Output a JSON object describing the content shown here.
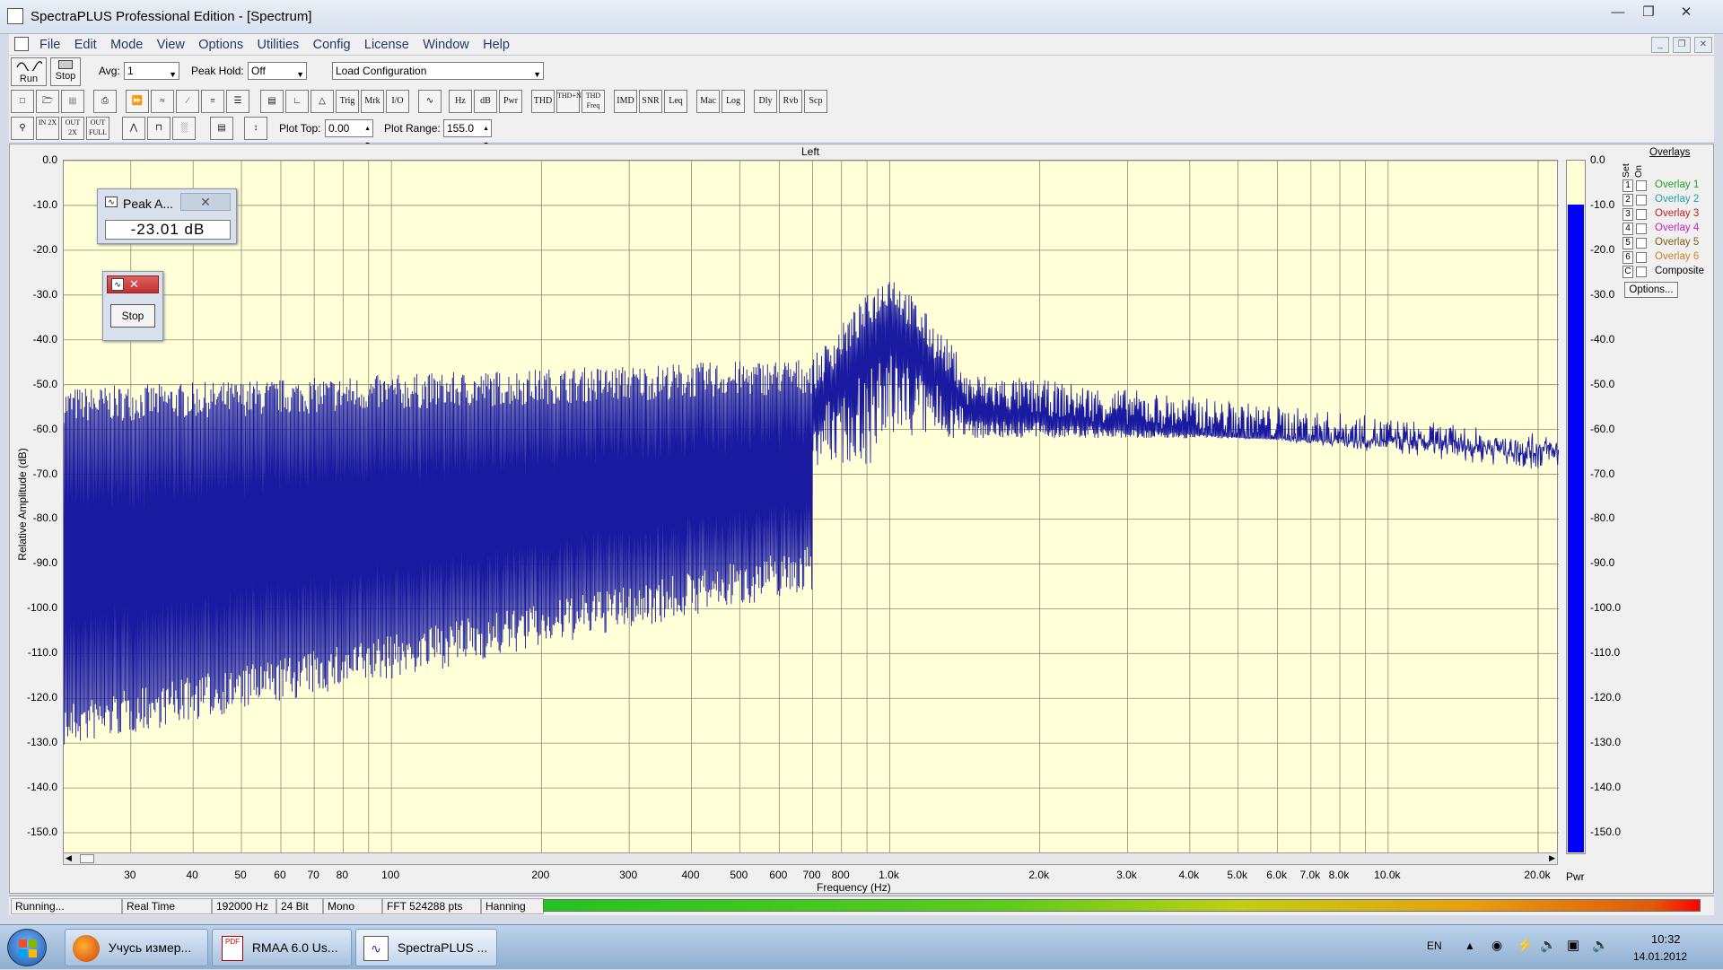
{
  "window": {
    "title": "SpectraPLUS Professional Edition - [Spectrum]",
    "controls": [
      "minimize",
      "maximize",
      "close"
    ]
  },
  "menu": [
    "File",
    "Edit",
    "Mode",
    "View",
    "Options",
    "Utilities",
    "Config",
    "License",
    "Window",
    "Help"
  ],
  "toolbar1": {
    "run_label": "Run",
    "stop_label": "Stop",
    "avg_label": "Avg:",
    "avg_value": "1",
    "peak_hold_label": "Peak Hold:",
    "peak_hold_value": "Off",
    "config_value": "Load Configuration"
  },
  "toolbar2": [
    "Trig",
    "Mrk",
    "I/O",
    "Hz",
    "dB",
    "Pwr",
    "THD",
    "THD+N",
    "THD Freq",
    "IMD",
    "SNR",
    "Leq",
    "Mac",
    "Log",
    "Dly",
    "Rvb",
    "Scp"
  ],
  "toolbar3": {
    "zoom_labels": [
      "IN 2X",
      "OUT 2X",
      "OUT FULL"
    ],
    "plot_top_label": "Plot Top:",
    "plot_top_value": "0.00",
    "plot_range_label": "Plot Range:",
    "plot_range_value": "155.0"
  },
  "plot": {
    "channel_title": "Left",
    "ylabel": "Relative Amplitude (dB)",
    "xlabel": "Frequency (Hz)",
    "y_ticks": [
      "0.0",
      "-10.0",
      "-20.0",
      "-30.0",
      "-40.0",
      "-50.0",
      "-60.0",
      "-70.0",
      "-80.0",
      "-90.0",
      "-100.0",
      "-110.0",
      "-120.0",
      "-130.0",
      "-140.0",
      "-150.0"
    ],
    "x_ticks": [
      "30",
      "40",
      "50",
      "60",
      "70",
      "80",
      "100",
      "200",
      "300",
      "400",
      "500",
      "600",
      "700",
      "800",
      "1.0k",
      "2.0k",
      "3.0k",
      "4.0k",
      "5.0k",
      "6.0k",
      "7.0k",
      "8.0k",
      "10.0k",
      "20.0k"
    ],
    "line_color": "#1a1aa0",
    "background": "#ffffd8"
  },
  "meter": {
    "label": "Pwr",
    "level_db": -10.0,
    "ticks": [
      "0.0",
      "-10.0",
      "-20.0",
      "-30.0",
      "-40.0",
      "-50.0",
      "-60.0",
      "-70.0",
      "-80.0",
      "-90.0",
      "-100.0",
      "-110.0",
      "-120.0",
      "-130.0",
      "-140.0",
      "-150.0"
    ],
    "color": "#0000ff"
  },
  "overlays": {
    "header": "Overlays",
    "col_set": "Set",
    "col_on": "On",
    "items": [
      {
        "num": "1",
        "name": "Overlay 1",
        "color": "#20a020"
      },
      {
        "num": "2",
        "name": "Overlay 2",
        "color": "#20a0a0"
      },
      {
        "num": "3",
        "name": "Overlay 3",
        "color": "#c02020"
      },
      {
        "num": "4",
        "name": "Overlay 4",
        "color": "#c020c0"
      },
      {
        "num": "5",
        "name": "Overlay 5",
        "color": "#806010"
      },
      {
        "num": "6",
        "name": "Overlay 6",
        "color": "#d08020"
      },
      {
        "num": "C",
        "name": "Composite",
        "color": "#000000"
      }
    ],
    "options_label": "Options..."
  },
  "peak_panel": {
    "title": "Peak A...",
    "value": "-23.01 dB"
  },
  "stop_panel": {
    "button_label": "Stop"
  },
  "statusbar": {
    "state": "Running...",
    "mode": "Real Time",
    "rate": "192000 Hz",
    "bits": "24 Bit",
    "channels": "Mono",
    "fft": "FFT 524288 pts",
    "window": "Hanning"
  },
  "taskbar": {
    "items": [
      {
        "label": "Учусь измер..."
      },
      {
        "label": "RMAA 6.0 Us..."
      },
      {
        "label": "SpectraPLUS ..."
      }
    ],
    "lang": "EN",
    "time": "10:32",
    "date": "14.01.2012"
  }
}
